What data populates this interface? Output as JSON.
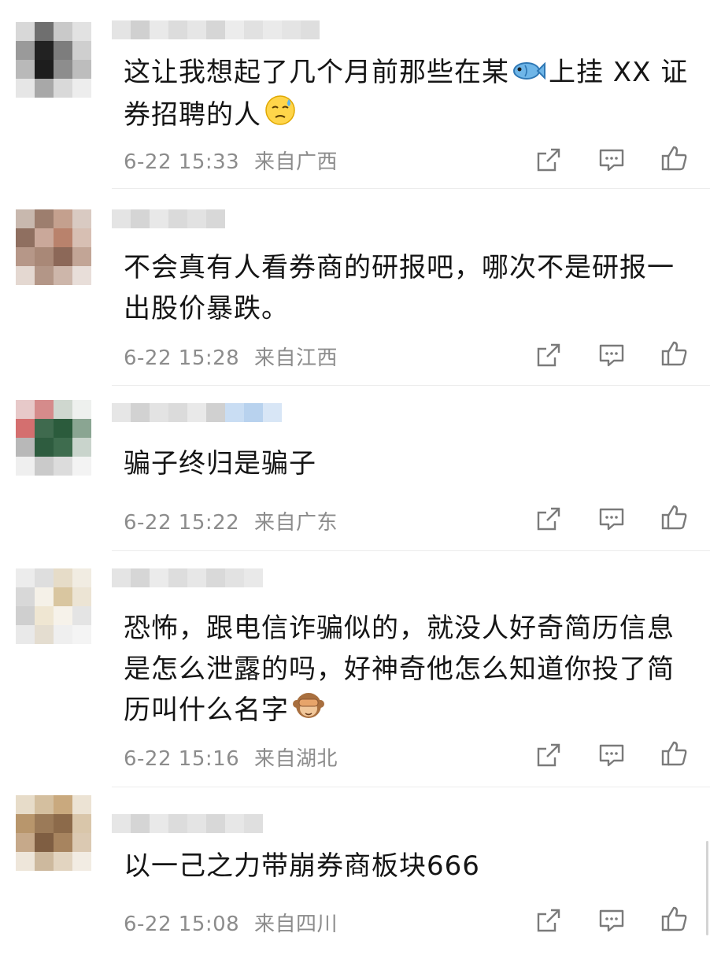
{
  "comments": [
    {
      "text_parts": [
        "这让我想起了几个月前那些在某",
        "上挂 XX 证券招聘的人"
      ],
      "emoji_inline": "fish-icon",
      "emoji_end": "sweat-face-icon",
      "time": "6-22 15:33",
      "location": "来自广西",
      "name_partial": "ookerde"
    },
    {
      "text": "不会真有人看券商的研报吧，哪次不是研报一出股价暴跌。",
      "time": "6-22 15:28",
      "location": "来自江西"
    },
    {
      "text": "骗子终归是骗子",
      "time": "6-22 15:22",
      "location": "来自广东"
    },
    {
      "text": "恐怖，跟电信诈骗似的，就没人好奇简历信息是怎么泄露的吗，好神奇他怎么知道你投了简历叫什么名字",
      "emoji_end": "see-no-evil-monkey-icon",
      "time": "6-22 15:16",
      "location": "来自湖北"
    },
    {
      "text": "以一己之力带崩券商板块666",
      "time": "6-22 15:08",
      "location": "来自四川"
    }
  ],
  "icons": {
    "share": "share-icon",
    "reply": "comment-icon",
    "like": "thumbs-up-icon"
  },
  "colors": {
    "meta_text": "#8c8c8c",
    "icon": "#7a7a7a",
    "divider": "#ececec"
  }
}
